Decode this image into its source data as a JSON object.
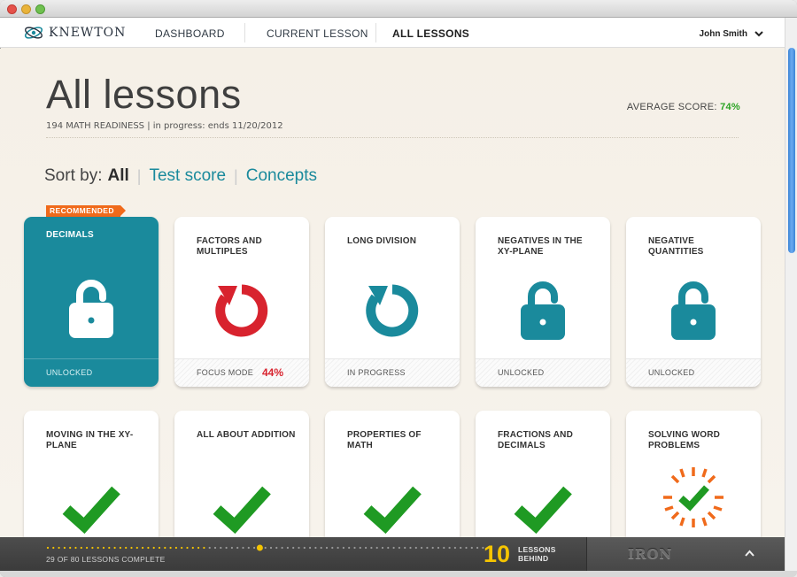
{
  "nav": {
    "brand": "KNEWTON",
    "links": [
      "DASHBOARD",
      "CURRENT LESSON",
      "ALL LESSONS"
    ],
    "active": "ALL LESSONS",
    "user": "John Smith"
  },
  "header": {
    "title": "All lessons",
    "subtitle": "194 MATH READINESS | in progress: ends 11/20/2012",
    "avg_label": "AVERAGE SCORE:",
    "avg_value": "74%"
  },
  "sort": {
    "label": "Sort by:",
    "options": [
      "All",
      "Test score",
      "Concepts"
    ],
    "selected": "All"
  },
  "lessons": [
    {
      "title": "DECIMALS",
      "status": "UNLOCKED",
      "icon": "unlock-icon",
      "recommended": "RECOMMENDED"
    },
    {
      "title": "FACTORS AND MULTIPLES",
      "status": "FOCUS MODE",
      "score": "44%",
      "icon": "refresh-icon-red"
    },
    {
      "title": "LONG DIVISION",
      "status": "IN PROGRESS",
      "icon": "refresh-icon-teal"
    },
    {
      "title": "NEGATIVES IN THE XY-PLANE",
      "status": "UNLOCKED",
      "icon": "unlock-icon"
    },
    {
      "title": "NEGATIVE QUANTITIES",
      "status": "UNLOCKED",
      "icon": "unlock-icon"
    },
    {
      "title": "MOVING IN THE XY-PLANE",
      "icon": "check-icon"
    },
    {
      "title": "ALL ABOUT ADDITION",
      "icon": "check-icon"
    },
    {
      "title": "PROPERTIES OF MATH",
      "icon": "check-icon"
    },
    {
      "title": "FRACTIONS AND DECIMALS",
      "icon": "check-icon"
    },
    {
      "title": "SOLVING WORD PROBLEMS",
      "icon": "check-burst-icon"
    }
  ],
  "progress": {
    "text": "29 OF 80 LESSONS COMPLETE",
    "completed": 29,
    "total": 80,
    "behind_count": "10",
    "behind_line1": "LESSONS",
    "behind_line2": "BEHIND",
    "rank": "IRON"
  },
  "colors": {
    "teal": "#1a8a9c",
    "red": "#d8232e",
    "green": "#1f9a23",
    "orange": "#f06a1b",
    "gold": "#f5c400"
  }
}
